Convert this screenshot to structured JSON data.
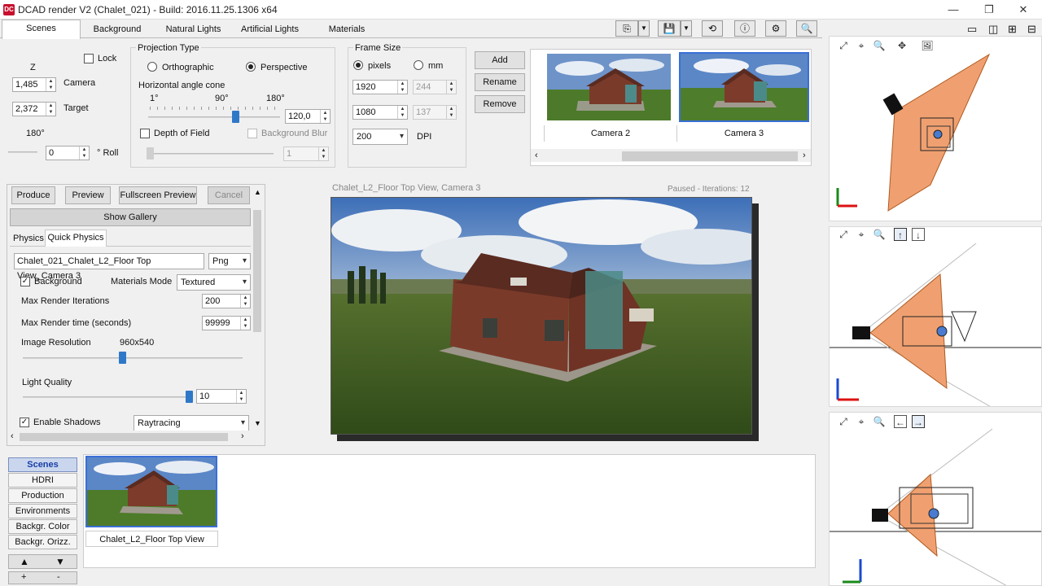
{
  "window": {
    "title": "DCAD render V2 (Chalet_021) - Build: 2016.11.25.1306 x64",
    "app_icon": "DC",
    "minimize": "—",
    "maximize": "❐",
    "close": "✕"
  },
  "tabs": [
    "Scenes",
    "Background",
    "Natural Lights",
    "Artificial Lights",
    "Materials"
  ],
  "toolbar_icons": [
    "export-icon",
    "save-icon",
    "orbit-icon",
    "info-icon",
    "settings-icon",
    "zoom-icon"
  ],
  "camera": {
    "z_label": "Z",
    "lock_label": "Lock",
    "camera_value": "1,485",
    "camera_label": "Camera",
    "target_value": "2,372",
    "target_label": "Target",
    "roll_max": "180°",
    "roll_value": "0",
    "roll_label": "° Roll",
    "roll_level": 0.0
  },
  "projection": {
    "title": "Projection Type",
    "ortho_label": "Orthographic",
    "persp_label": "Perspective",
    "selected": "Perspective",
    "cone_label": "Horizontal angle cone",
    "tick_min": "1°",
    "tick_mid": "90°",
    "tick_max": "180°",
    "cone_value": "120,0",
    "cone_level": 0.66,
    "dof_label": "Depth of Field",
    "bg_blur_label": "Background Blur",
    "blur_value": "1"
  },
  "frame_size": {
    "title": "Frame Size",
    "pixels_label": "pixels",
    "mm_label": "mm",
    "width_px": "1920",
    "width_mm": "244",
    "height_px": "1080",
    "height_mm": "137",
    "dpi_value": "200",
    "dpi_label": "DPI"
  },
  "camera_buttons": {
    "add": "Add",
    "rename": "Rename",
    "remove": "Remove"
  },
  "cameras": [
    {
      "label": "Camera 2"
    },
    {
      "label": "Camera 3"
    }
  ],
  "produce": {
    "produce": "Produce",
    "preview": "Preview",
    "fullscreen": "Fullscreen Preview",
    "cancel": "Cancel",
    "show_gallery": "Show Gallery",
    "subtab_physics": "Physics",
    "subtab_quick": "Quick Physics",
    "filename": "Chalet_021_Chalet_L2_Floor Top View_Camera 3",
    "format": "Png",
    "background_label": "Background",
    "materials_mode_label": "Materials Mode",
    "materials_mode": "Textured",
    "max_iter_label": "Max Render Iterations",
    "max_iter": "200",
    "max_time_label": "Max Render time (seconds)",
    "max_time": "99999",
    "img_res_label": "Image Resolution",
    "img_res": "960x540",
    "img_res_level": 0.45,
    "light_quality_label": "Light Quality",
    "light_quality": "10",
    "light_quality_level": 1.0,
    "shadows_label": "Enable Shadows",
    "shadows_mode": "Raytracing"
  },
  "render": {
    "title": "Chalet_L2_Floor Top View, Camera 3",
    "status": "Paused - Iterations: 12"
  },
  "nav": [
    "Scenes",
    "HDRI",
    "Production",
    "Environments",
    "Backgr. Color",
    "Backgr. Orizz."
  ],
  "nav_up": "▲",
  "nav_down": "▼",
  "nav_add": "+",
  "nav_remove": "-",
  "gallery": [
    {
      "label": "Chalet_L2_Floor Top View"
    }
  ],
  "viewport_tools": [
    "fit-icon",
    "target-icon",
    "zoom-icon",
    "pan-icon",
    "image-icon"
  ],
  "colors": {
    "accent": "#2f78c8",
    "frustum": "#f0a070",
    "nav_active": "#c9d6ee"
  }
}
